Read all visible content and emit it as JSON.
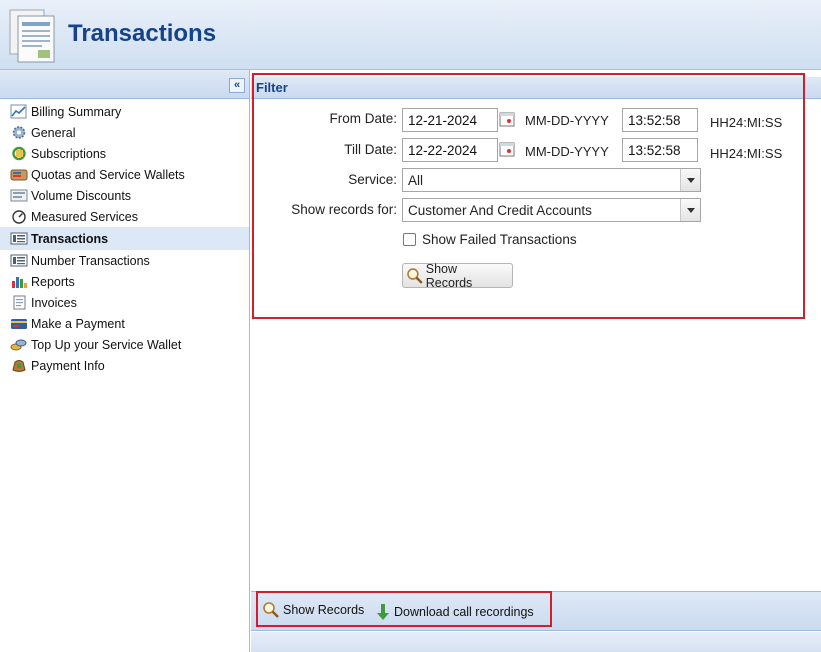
{
  "header": {
    "title": "Transactions",
    "icon": "transactions-document-icon"
  },
  "sidebar": {
    "collapse_label": "«",
    "items": [
      {
        "label": "Billing Summary",
        "icon": "chart-icon"
      },
      {
        "label": "General",
        "icon": "gear-icon"
      },
      {
        "label": "Subscriptions",
        "icon": "recycle-icon"
      },
      {
        "label": "Quotas and Service Wallets",
        "icon": "wallet-icon"
      },
      {
        "label": "Volume Discounts",
        "icon": "discount-icon"
      },
      {
        "label": "Measured Services",
        "icon": "gauge-icon"
      },
      {
        "label": "Transactions",
        "icon": "list-icon",
        "active": true
      },
      {
        "label": "Number Transactions",
        "icon": "list-icon"
      },
      {
        "label": "Reports",
        "icon": "bar-chart-icon"
      },
      {
        "label": "Invoices",
        "icon": "invoice-icon"
      },
      {
        "label": "Make a Payment",
        "icon": "credit-card-icon"
      },
      {
        "label": "Top Up your Service Wallet",
        "icon": "coins-icon"
      },
      {
        "label": "Payment Info",
        "icon": "money-bag-icon"
      }
    ]
  },
  "filter": {
    "title": "Filter",
    "from_date": {
      "label": "From Date:",
      "date": "12-21-2024",
      "date_format": "MM-DD-YYYY",
      "time": "13:52:58",
      "time_format": "HH24:MI:SS"
    },
    "till_date": {
      "label": "Till Date:",
      "date": "12-22-2024",
      "date_format": "MM-DD-YYYY",
      "time": "13:52:58",
      "time_format": "HH24:MI:SS"
    },
    "service": {
      "label": "Service:",
      "value": "All"
    },
    "show_records_for": {
      "label": "Show records for:",
      "value": "Customer And Credit Accounts"
    },
    "show_failed": {
      "label": "Show Failed Transactions",
      "checked": false
    },
    "show_records_button": "Show Records"
  },
  "toolbar": {
    "show_records": "Show Records",
    "download": "Download call recordings"
  },
  "colors": {
    "highlight_border": "#d0202c",
    "title": "#15428b",
    "panel": "#dfe9f6"
  }
}
